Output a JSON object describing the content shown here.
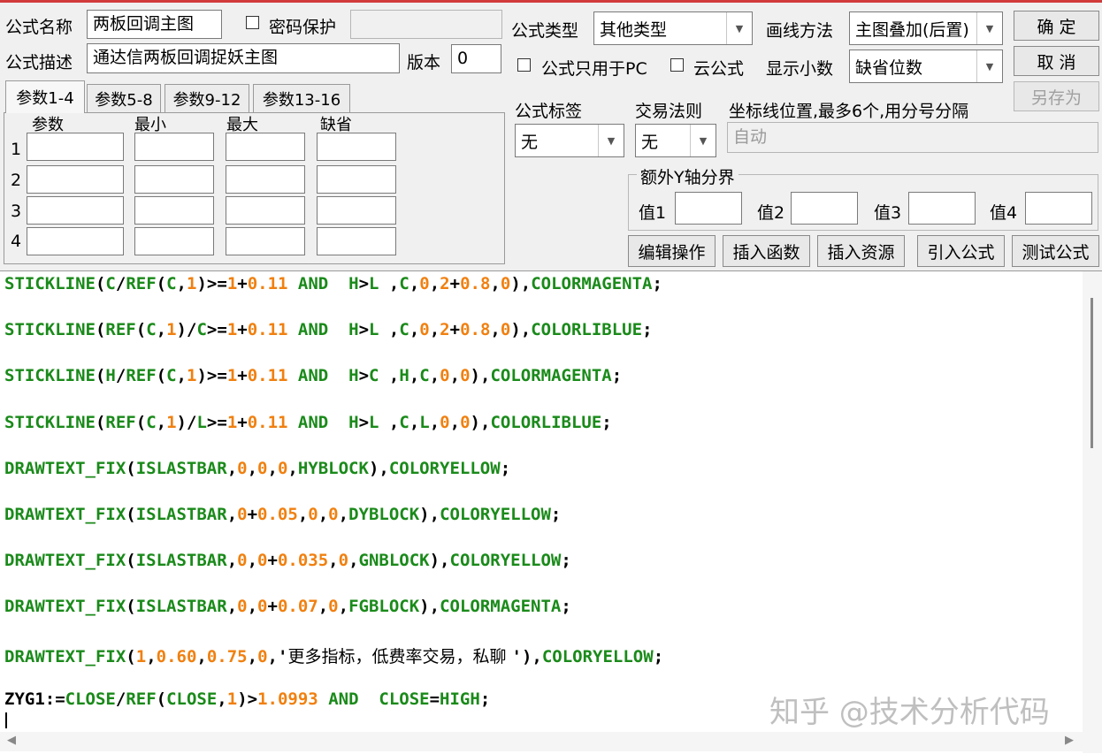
{
  "top": {
    "formula_name_label": "公式名称",
    "formula_name_value": "两板回调主图",
    "password_label": "密码保护",
    "formula_desc_label": "公式描述",
    "formula_desc_value": "通达信两板回调捉妖主图",
    "version_label": "版本",
    "version_value": "0",
    "formula_type_label": "公式类型",
    "formula_type_value": "其他类型",
    "draw_method_label": "画线方法",
    "draw_method_value": "主图叠加(后置)",
    "pc_only_label": "公式只用于PC",
    "cloud_label": "云公式",
    "decimal_label": "显示小数",
    "decimal_value": "缺省位数",
    "formula_tag_label": "公式标签",
    "formula_tag_value": "无",
    "trade_rule_label": "交易法则",
    "trade_rule_value": "无",
    "axis_label": "坐标线位置,最多6个,用分号分隔",
    "axis_value": "自动"
  },
  "buttons": {
    "ok": "确  定",
    "cancel": "取  消",
    "save_as": "另存为",
    "edit": "编辑操作",
    "insert_func": "插入函数",
    "insert_res": "插入资源",
    "import": "引入公式",
    "test": "测试公式"
  },
  "params": {
    "tabs": [
      "参数1-4",
      "参数5-8",
      "参数9-12",
      "参数13-16"
    ],
    "headers": [
      "参数",
      "最小",
      "最大",
      "缺省"
    ],
    "rows": [
      "1",
      "2",
      "3",
      "4"
    ]
  },
  "yaxis": {
    "title": "额外Y轴分界",
    "labels": [
      "值1",
      "值2",
      "值3",
      "值4"
    ]
  },
  "code": {
    "lines": [
      "STICKLINE(C/REF(C,1)>=1+0.11 AND  H>L ,C,0,2+0.8,0),COLORMAGENTA;",
      "STICKLINE(REF(C,1)/C>=1+0.11 AND  H>L ,C,0,2+0.8,0),COLORLIBLUE;",
      "STICKLINE(H/REF(C,1)>=1+0.11 AND  H>C ,H,C,0,0),COLORMAGENTA;",
      "STICKLINE(REF(C,1)/L>=1+0.11 AND  H>L ,C,L,0,0),COLORLIBLUE;",
      "DRAWTEXT_FIX(ISLASTBAR,0,0,0,HYBLOCK),COLORYELLOW;",
      "DRAWTEXT_FIX(ISLASTBAR,0+0.05,0,0,DYBLOCK),COLORYELLOW;",
      "DRAWTEXT_FIX(ISLASTBAR,0,0+0.035,0,GNBLOCK),COLORYELLOW;",
      "DRAWTEXT_FIX(ISLASTBAR,0,0+0.07,0,FGBLOCK),COLORMAGENTA;",
      "DRAWTEXT_FIX(1,0.60,0.75,0,'更多指标，低费率交易，私聊 '),COLORYELLOW;",
      "ZYG1:=CLOSE/REF(CLOSE,1)>1.0993 AND  CLOSE=HIGH;"
    ]
  },
  "watermark": "知乎 @技术分析代码"
}
